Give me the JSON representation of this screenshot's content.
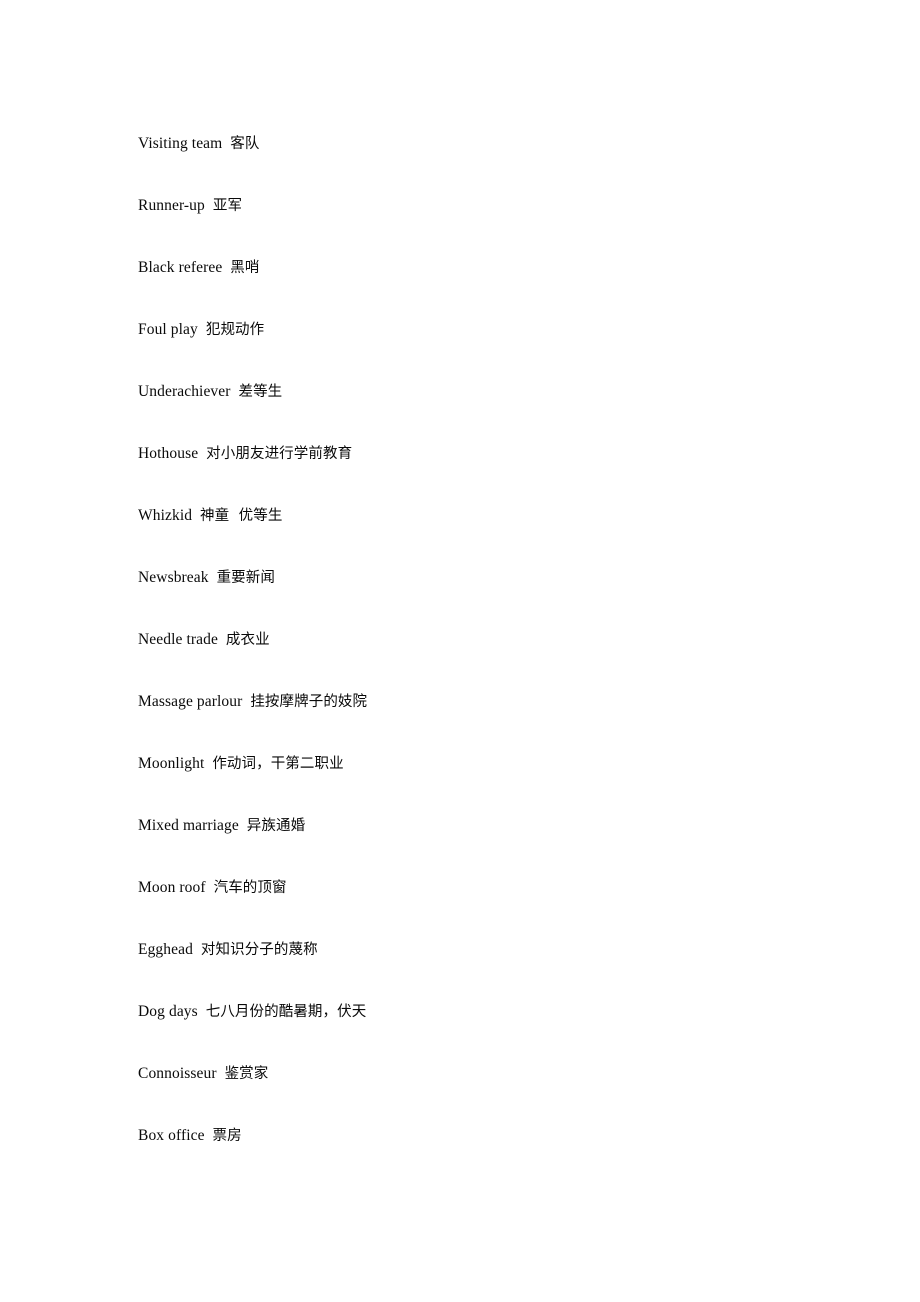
{
  "document": {
    "page_background": "#ffffff",
    "text_color": "#0a0a0a",
    "entries": [
      {
        "term": "Visiting team",
        "separator": "  ",
        "gloss": "客队",
        "gap_before": false
      },
      {
        "term": "Runner-up",
        "separator": "  ",
        "gloss": "亚军",
        "gap_before": false
      },
      {
        "term": "Black referee",
        "separator": "  ",
        "gloss": "黑哨",
        "gap_before": false
      },
      {
        "term": "Foul play",
        "separator": "  ",
        "gloss": "犯规动作",
        "gap_before": false
      },
      {
        "term": "Underachiever",
        "separator": "  ",
        "gloss": "差等生",
        "gap_before": false
      },
      {
        "term": "Hothouse",
        "separator": "  ",
        "gloss": "对小朋友进行学前教育",
        "gap_before": false
      },
      {
        "term": "Whizkid",
        "separator": "  ",
        "gloss": "神童  优等生",
        "gap_before": false
      },
      {
        "term": "Newsbreak",
        "separator": "  ",
        "gloss": "重要新闻",
        "gap_before": true
      },
      {
        "term": "Needle trade",
        "separator": "  ",
        "gloss": "成衣业",
        "gap_before": false
      },
      {
        "term": "Massage parlour",
        "separator": "  ",
        "gloss": "挂按摩牌子的妓院",
        "gap_before": false
      },
      {
        "term": "Moonlight",
        "separator": "  ",
        "gloss": "作动词，干第二职业",
        "gap_before": false
      },
      {
        "term": "Mixed marriage",
        "separator": "  ",
        "gloss": "异族通婚",
        "gap_before": false
      },
      {
        "term": "Moon roof",
        "separator": "  ",
        "gloss": "汽车的顶窗",
        "gap_before": false
      },
      {
        "term": "Egghead",
        "separator": "  ",
        "gloss": "对知识分子的蔑称",
        "gap_before": false
      },
      {
        "term": "Dog days",
        "separator": "  ",
        "gloss": "七八月份的酷暑期，伏天",
        "gap_before": false
      },
      {
        "term": "Connoisseur",
        "separator": "  ",
        "gloss": "鉴赏家",
        "gap_before": false
      },
      {
        "term": "Box office",
        "separator": "  ",
        "gloss": "票房",
        "gap_before": false
      }
    ]
  }
}
